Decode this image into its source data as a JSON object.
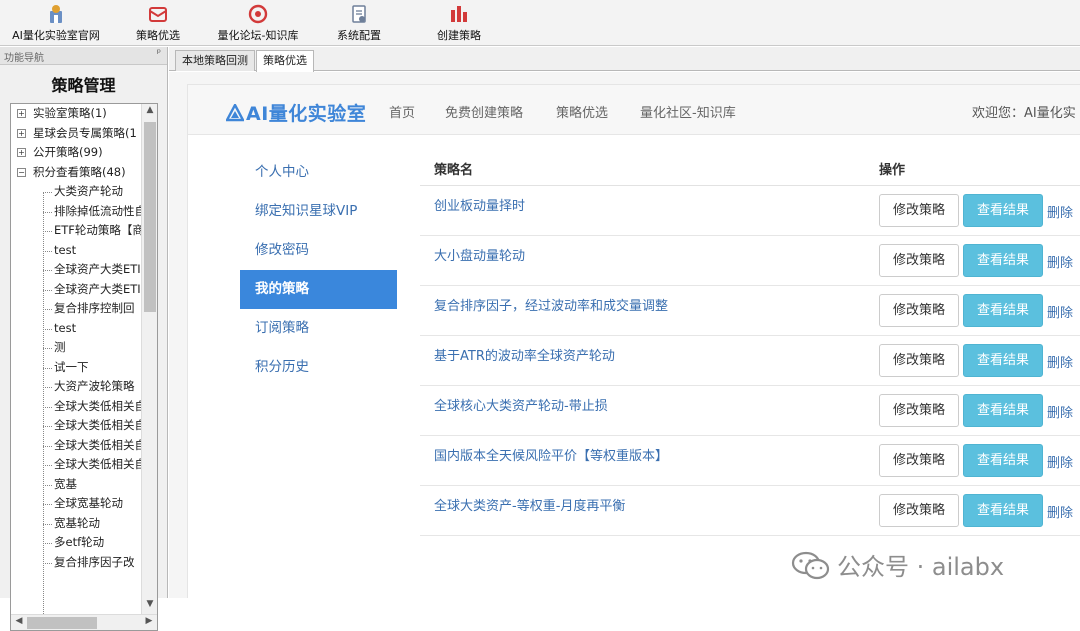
{
  "toolbar": {
    "items": [
      {
        "label": "AI量化实验室官网",
        "icon": "lab-home-icon"
      },
      {
        "label": "策略优选",
        "icon": "mail-icon"
      },
      {
        "label": "量化论坛-知识库",
        "icon": "forum-icon"
      },
      {
        "label": "系统配置",
        "icon": "config-document-icon"
      },
      {
        "label": "创建策略",
        "icon": "bar-chart-icon"
      }
    ]
  },
  "nav": {
    "header": "功能导航",
    "pin": "ᵖ",
    "title": "策略管理",
    "groups": [
      {
        "label": "实验室策略(1)",
        "expander": "+"
      },
      {
        "label": "星球会员专属策略(1",
        "expander": "+"
      },
      {
        "label": "公开策略(99)",
        "expander": "+"
      },
      {
        "label": "积分查看策略(48)",
        "expander": "−"
      }
    ],
    "children": [
      "大类资产轮动",
      "排除掉低流动性自",
      "ETF轮动策略【商",
      "test",
      "全球资产大类ETI",
      "全球资产大类ETI",
      "复合排序控制回",
      "test",
      "测",
      "试一下",
      "大资产波轮策略",
      "全球大类低相关自",
      "全球大类低相关自",
      "全球大类低相关自",
      "全球大类低相关自",
      "宽基",
      "全球宽基轮动",
      "宽基轮动",
      "多etf轮动",
      "复合排序因子改"
    ]
  },
  "tabs": [
    {
      "label": "本地策略回测"
    },
    {
      "label": "策略优选",
      "active": true
    }
  ],
  "site": {
    "logo": "AI量化实验室",
    "nav": [
      "首页",
      "免费创建策略",
      "策略优选",
      "量化社区-知识库"
    ],
    "welcome": "欢迎您：AI量化实"
  },
  "menu": [
    {
      "label": "个人中心"
    },
    {
      "label": "绑定知识星球VIP"
    },
    {
      "label": "修改密码"
    },
    {
      "label": "我的策略",
      "active": true
    },
    {
      "label": "订阅策略"
    },
    {
      "label": "积分历史"
    }
  ],
  "table": {
    "col_name": "策略名",
    "col_action": "操作",
    "edit_label": "修改策略",
    "view_label": "查看结果",
    "delete_label": "删除",
    "rows": [
      "创业板动量择时",
      "大小盘动量轮动",
      "复合排序因子，经过波动率和成交量调整",
      "基于ATR的波动率全球资产轮动",
      "全球核心大类资产轮动-带止损",
      "国内版本全天候风险平价【等权重版本】",
      "全球大类资产-等权重-月度再平衡"
    ]
  },
  "watermark": {
    "text": "公众号 · ailabx",
    "icon": "wechat-icon"
  },
  "colors": {
    "accent": "#3a87dc",
    "view_button": "#5bc0de",
    "link": "#3a6fb0"
  }
}
